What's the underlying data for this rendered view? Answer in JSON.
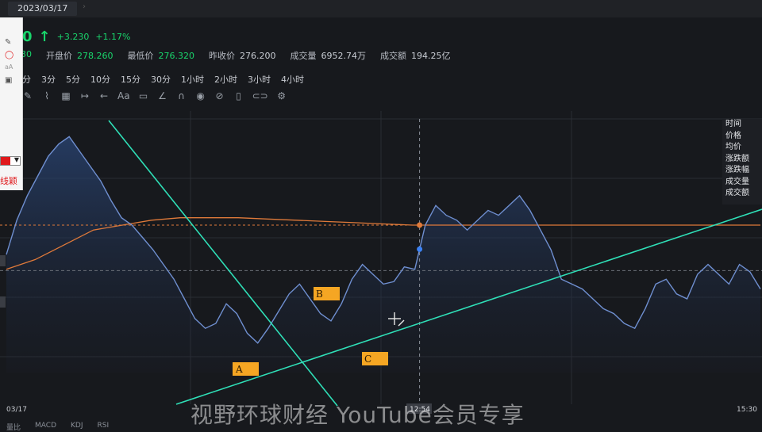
{
  "tab": {
    "date": "2023/03/17"
  },
  "quote": {
    "price_tail": "0",
    "change": "+3.230",
    "change_pct": "+1.17%",
    "prev_fragment": "30",
    "open_label": "开盘价",
    "open_value": "278.260",
    "low_label": "最低价",
    "low_value": "276.320",
    "prev_close_label": "昨收价",
    "prev_close_value": "276.200",
    "volume_label": "成交量",
    "volume_value": "6952.74万",
    "turnover_label": "成交额",
    "turnover_value": "194.25亿"
  },
  "periods": [
    "分",
    "3分",
    "5分",
    "10分",
    "15分",
    "30分",
    "1小时",
    "2小时",
    "3小时",
    "4小时"
  ],
  "tools": [
    "pen-icon",
    "zigzag-icon",
    "calendar-icon",
    "range-icon",
    "arrow-left-icon",
    "text-icon",
    "comment-icon",
    "line-icon",
    "magnet-icon",
    "eye-icon",
    "hide-icon",
    "trash-icon",
    "link-icon",
    "settings-icon"
  ],
  "side_panel": {
    "text": "线颖"
  },
  "legend": [
    "时间",
    "价格",
    "均价",
    "涨跌额",
    "涨跌幅",
    "成交量",
    "成交额"
  ],
  "watermark": "视野环球财经 YouTube会员专享",
  "bottom_indicators": [
    "量比",
    "MACD",
    "KDJ",
    "RSI"
  ],
  "colors": {
    "price_line": "#6f8fd0",
    "avg_line": "#e07a3a",
    "trend_line": "#2fe0b8",
    "label_box": "#f5a623",
    "up": "#19d46b"
  },
  "chart_data": {
    "type": "line",
    "x_labels": [
      "03/17",
      "12:54",
      "15:30"
    ],
    "crosshair_time": "12:54",
    "annotations": [
      "A",
      "B",
      "C"
    ],
    "series": [
      {
        "values": [
          0.48,
          0.62,
          0.72,
          0.8,
          0.88,
          0.93,
          0.96,
          0.9,
          0.84,
          0.78,
          0.7,
          0.63,
          0.6,
          0.55,
          0.5,
          0.44,
          0.38,
          0.3,
          0.22,
          0.18,
          0.2,
          0.28,
          0.24,
          0.16,
          0.12,
          0.18,
          0.25,
          0.32,
          0.36,
          0.3,
          0.24,
          0.21,
          0.28,
          0.38,
          0.44,
          0.4,
          0.36,
          0.37,
          0.43,
          0.42,
          0.6,
          0.68,
          0.64,
          0.62,
          0.58,
          0.62,
          0.66,
          0.64,
          0.68,
          0.72,
          0.66,
          0.58,
          0.5,
          0.38,
          0.36,
          0.34,
          0.3,
          0.26,
          0.24,
          0.2,
          0.18,
          0.26,
          0.36,
          0.38,
          0.32,
          0.3,
          0.4,
          0.44,
          0.4,
          0.36,
          0.44,
          0.41,
          0.34
        ]
      },
      {
        "values": [
          0.42,
          0.46,
          0.52,
          0.58,
          0.6,
          0.62,
          0.63,
          0.63,
          0.63,
          0.625,
          0.62,
          0.615,
          0.61,
          0.605,
          0.6,
          0.6,
          0.6,
          0.6,
          0.6,
          0.6,
          0.6,
          0.6,
          0.6,
          0.6,
          0.6,
          0.6,
          0.6
        ]
      }
    ],
    "prev_close_level": 0.415
  }
}
